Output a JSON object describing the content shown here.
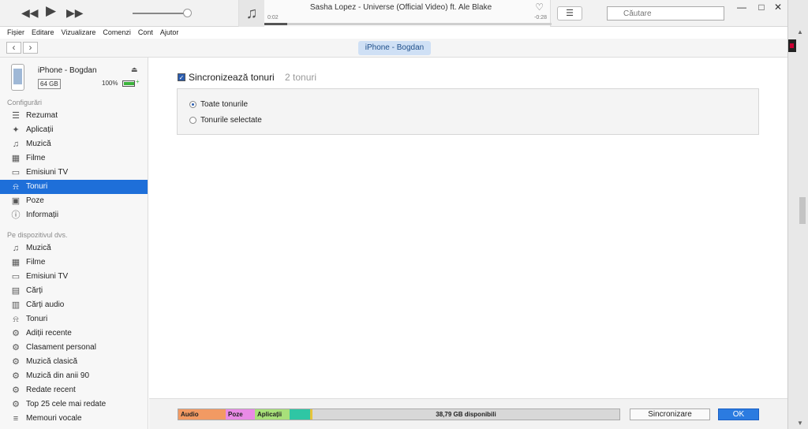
{
  "player": {
    "prev_icon": "rewind-icon",
    "play_icon": "play-icon",
    "next_icon": "fast-forward-icon",
    "now_playing_title": "Sasha Lopez - Universe (Official Video) ft. Ale Blake",
    "time_elapsed": "0:02",
    "time_remaining": "-0:28",
    "progress": 0.08,
    "volume": 0.9
  },
  "search": {
    "placeholder": "Căutare"
  },
  "menu": [
    "Fișier",
    "Editare",
    "Vizualizare",
    "Comenzi",
    "Cont",
    "Ajutor"
  ],
  "nav": {
    "device_tab": "iPhone - Bogdan"
  },
  "device": {
    "name": "iPhone - Bogdan",
    "capacity": "64 GB",
    "battery": "100%"
  },
  "sidebar": {
    "section1": "Configurări",
    "settings": [
      {
        "label": "Rezumat",
        "icon": "summary-icon"
      },
      {
        "label": "Aplicații",
        "icon": "apps-icon"
      },
      {
        "label": "Muzică",
        "icon": "music-note-icon"
      },
      {
        "label": "Filme",
        "icon": "film-icon"
      },
      {
        "label": "Emisiuni TV",
        "icon": "tv-icon"
      },
      {
        "label": "Tonuri",
        "icon": "bell-icon"
      },
      {
        "label": "Poze",
        "icon": "camera-icon"
      },
      {
        "label": "Informații",
        "icon": "info-icon"
      }
    ],
    "section2": "Pe dispozitivul dvs.",
    "on_device": [
      {
        "label": "Muzică",
        "icon": "music-note-icon"
      },
      {
        "label": "Filme",
        "icon": "film-icon"
      },
      {
        "label": "Emisiuni TV",
        "icon": "tv-icon"
      },
      {
        "label": "Cărți",
        "icon": "book-icon"
      },
      {
        "label": "Cărți audio",
        "icon": "audiobook-icon"
      },
      {
        "label": "Tonuri",
        "icon": "bell-icon"
      },
      {
        "label": "Adiții recente",
        "icon": "gear-icon"
      },
      {
        "label": "Clasament personal",
        "icon": "gear-icon"
      },
      {
        "label": "Muzică clasică",
        "icon": "gear-icon"
      },
      {
        "label": "Muzică din anii 90",
        "icon": "gear-icon"
      },
      {
        "label": "Redate recent",
        "icon": "gear-icon"
      },
      {
        "label": "Top 25 cele mai redate",
        "icon": "gear-icon"
      },
      {
        "label": "Memouri vocale",
        "icon": "microphone-icon"
      }
    ]
  },
  "main": {
    "sync_label": "Sincronizează tonuri",
    "sync_count": "2 tonuri",
    "sync_checked": true,
    "options": [
      {
        "label": "Toate tonurile",
        "selected": true
      },
      {
        "label": "Tonurile selectate",
        "selected": false
      }
    ]
  },
  "storage": {
    "segments": [
      {
        "label": "Audio",
        "color": "#f29a63",
        "fraction": 0.108
      },
      {
        "label": "Poze",
        "color": "#e98be6",
        "fraction": 0.066
      },
      {
        "label": "Aplicații",
        "color": "#a8e07a",
        "fraction": 0.078
      },
      {
        "label": "",
        "color": "#2fc6a4",
        "fraction": 0.046
      },
      {
        "label": "",
        "color": "#e6c43a",
        "fraction": 0.006
      }
    ],
    "free_label": "38,79 GB disponibili",
    "free_color": "#d8d8d8"
  },
  "buttons": {
    "sync": "Sincronizare",
    "ok": "OK"
  }
}
